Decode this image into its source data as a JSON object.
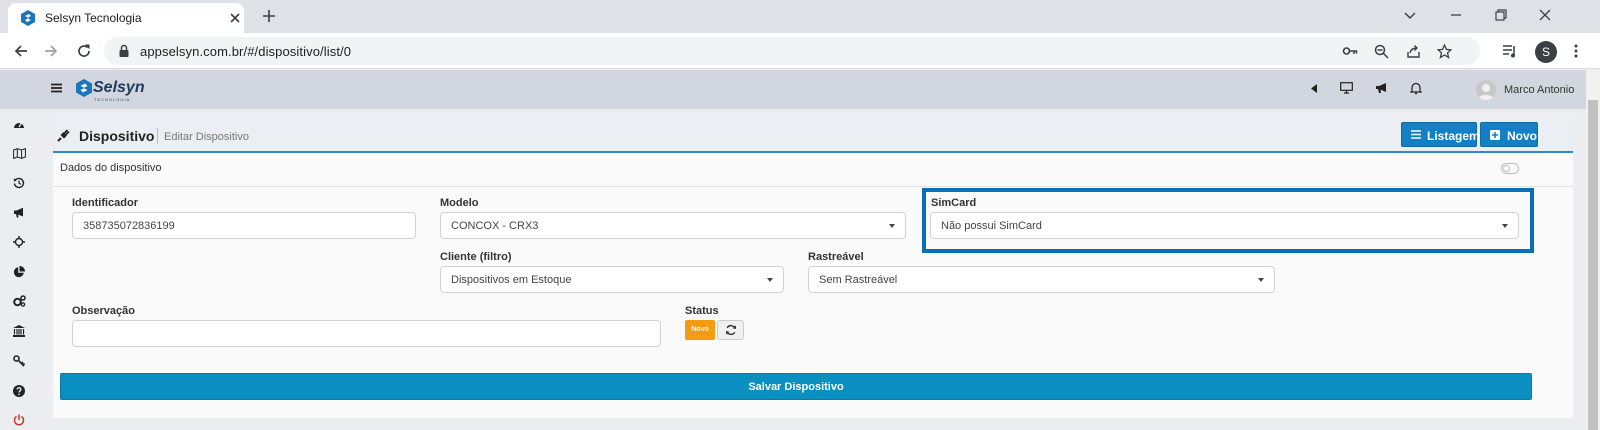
{
  "browser": {
    "tab_title": "Selsyn Tecnologia",
    "url": "appselsyn.com.br/#/dispositivo/list/0",
    "profile_initial": "S"
  },
  "app": {
    "brand": "Selsyn",
    "brand_sub": "TECNOLOGIA",
    "user_name": "Marco Antonio"
  },
  "page": {
    "title": "Dispositivo",
    "subtitle": "Editar Dispositivo",
    "listagem_label": "Listagem",
    "novo_label": "Novo"
  },
  "form": {
    "section_title": "Dados do dispositivo",
    "identificador": {
      "label": "Identificador",
      "value": "358735072836199"
    },
    "modelo": {
      "label": "Modelo",
      "value": "CONCOX - CRX3"
    },
    "simcard": {
      "label": "SimCard",
      "value": "Não possui SimCard"
    },
    "cliente": {
      "label": "Cliente (filtro)",
      "value": "Dispositivos em Estoque"
    },
    "rastreavel": {
      "label": "Rastreável",
      "value": "Sem Rastreável"
    },
    "observacao": {
      "label": "Observação",
      "value": ""
    },
    "status": {
      "label": "Status",
      "badge": "Novo"
    },
    "save_label": "Salvar Dispositivo"
  },
  "colors": {
    "primary": "#137fc4",
    "save": "#0a8fc1",
    "highlight": "#0b6fb8",
    "status_new": "#f39c12"
  }
}
